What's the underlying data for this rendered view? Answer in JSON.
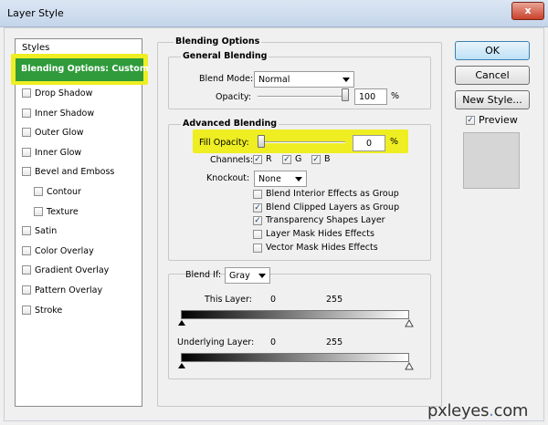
{
  "window": {
    "title": "Layer Style",
    "close_label": "x"
  },
  "styles_panel": {
    "header": "Styles",
    "selected": "Blending Options: Custom",
    "items": [
      {
        "label": "Drop Shadow",
        "checked": false,
        "indent": false
      },
      {
        "label": "Inner Shadow",
        "checked": false,
        "indent": false
      },
      {
        "label": "Outer Glow",
        "checked": false,
        "indent": false
      },
      {
        "label": "Inner Glow",
        "checked": false,
        "indent": false
      },
      {
        "label": "Bevel and Emboss",
        "checked": false,
        "indent": false
      },
      {
        "label": "Contour",
        "checked": false,
        "indent": true
      },
      {
        "label": "Texture",
        "checked": false,
        "indent": true
      },
      {
        "label": "Satin",
        "checked": false,
        "indent": false
      },
      {
        "label": "Color Overlay",
        "checked": false,
        "indent": false
      },
      {
        "label": "Gradient Overlay",
        "checked": false,
        "indent": false
      },
      {
        "label": "Pattern Overlay",
        "checked": false,
        "indent": false
      },
      {
        "label": "Stroke",
        "checked": false,
        "indent": false
      }
    ]
  },
  "blending_options": {
    "title": "Blending Options",
    "general": {
      "title": "General Blending",
      "blend_mode_label": "Blend Mode:",
      "blend_mode_value": "Normal",
      "opacity_label": "Opacity:",
      "opacity_value": "100",
      "opacity_unit": "%",
      "opacity_level": 1.0
    },
    "advanced": {
      "title": "Advanced Blending",
      "fill_opacity_label": "Fill Opacity:",
      "fill_opacity_value": "0",
      "fill_opacity_unit": "%",
      "fill_opacity_level": 0.0,
      "channels_label": "Channels:",
      "channels": [
        {
          "label": "R",
          "checked": true
        },
        {
          "label": "G",
          "checked": true
        },
        {
          "label": "B",
          "checked": true
        }
      ],
      "knockout_label": "Knockout:",
      "knockout_value": "None",
      "options": [
        {
          "label": "Blend Interior Effects as Group",
          "checked": false
        },
        {
          "label": "Blend Clipped Layers as Group",
          "checked": true
        },
        {
          "label": "Transparency Shapes Layer",
          "checked": true
        },
        {
          "label": "Layer Mask Hides Effects",
          "checked": false
        },
        {
          "label": "Vector Mask Hides Effects",
          "checked": false
        }
      ]
    },
    "blend_if": {
      "label": "Blend If:",
      "value": "Gray",
      "this_layer_label": "This Layer:",
      "this_layer_min": "0",
      "this_layer_max": "255",
      "underlying_label": "Underlying Layer:",
      "underlying_min": "0",
      "underlying_max": "255"
    }
  },
  "buttons": {
    "ok": "OK",
    "cancel": "Cancel",
    "new_style": "New Style...",
    "preview_label": "Preview",
    "preview_checked": true
  },
  "watermark": {
    "prefix": "pxleyes",
    "dot": ".",
    "suffix": "com"
  },
  "colors": {
    "highlight": "#eeee22",
    "selected_green": "#2f9b3a",
    "ok_accent": "#bde0f6"
  }
}
